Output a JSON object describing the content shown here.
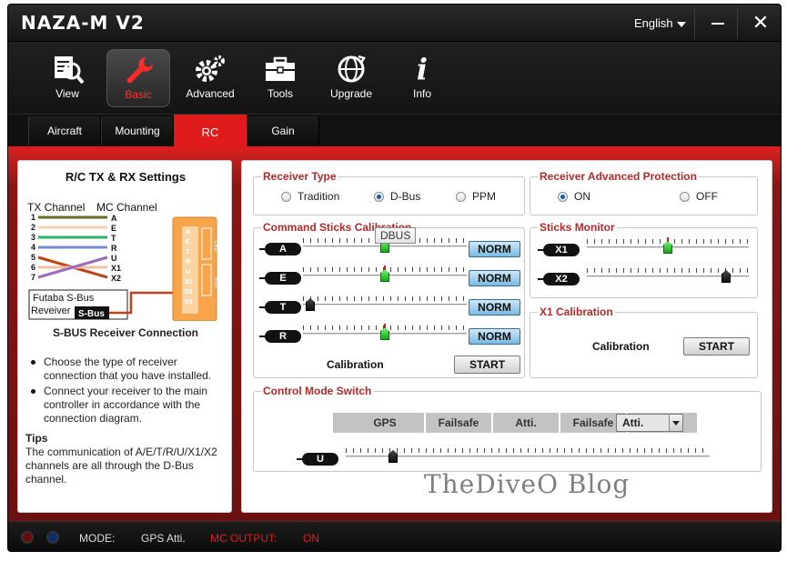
{
  "window": {
    "title": "NAZA-M V2",
    "language": "English",
    "close_glyph": "✕"
  },
  "toolbar": {
    "items": [
      {
        "label": "View",
        "icon": "view-icon"
      },
      {
        "label": "Basic",
        "icon": "wrench-icon",
        "active": true
      },
      {
        "label": "Advanced",
        "icon": "gears-icon"
      },
      {
        "label": "Tools",
        "icon": "toolbox-icon"
      },
      {
        "label": "Upgrade",
        "icon": "upgrade-icon"
      },
      {
        "label": "Info",
        "icon": "info-icon",
        "glyph": "i"
      }
    ]
  },
  "subtabs": [
    "Aircraft",
    "Mounting",
    "RC",
    "Gain"
  ],
  "active_subtab": "RC",
  "left": {
    "title": "R/C TX & RX Settings",
    "tx_channel_label": "TX Channel",
    "mc_channel_label": "MC Channel",
    "tx_numbers": [
      "1",
      "2",
      "3",
      "4",
      "5",
      "6",
      "7"
    ],
    "mc_channels": [
      "A",
      "E",
      "T",
      "R",
      "U",
      "X1",
      "X2"
    ],
    "receiver_name_line1": "Futaba S-Bus",
    "receiver_name_line2": "Reveiver",
    "sbus_tag": "S-Bus",
    "mc_port_labels": [
      "A",
      "E",
      "T",
      "R",
      "U",
      "X1",
      "X2",
      "X3"
    ],
    "mc_side_labels": [
      "LED",
      "EXP"
    ],
    "caption": "S-BUS Receiver Connection",
    "instructions": [
      "Choose the type of receiver connection that you have installed.",
      "Connect your receiver to the main controller in accordance with the connection diagram."
    ],
    "tips_title": "Tips",
    "tips_text": "The communication of A/E/T/R/U/X1/X2 channels are all through the D-Bus channel."
  },
  "receiver_type": {
    "title": "Receiver Type",
    "options": [
      "Tradition",
      "D-Bus",
      "PPM"
    ],
    "selected": "D-Bus"
  },
  "receiver_protection": {
    "title": "Receiver Advanced Protection",
    "options": [
      "ON",
      "OFF"
    ],
    "selected": "ON"
  },
  "command_sticks": {
    "title": "Command Sticks Calibration",
    "tooltip": "DBUS",
    "channels": [
      {
        "name": "A",
        "status": "NORM",
        "value": 0.5
      },
      {
        "name": "E",
        "status": "NORM",
        "value": 0.5
      },
      {
        "name": "T",
        "status": "NORM",
        "value": 0.02
      },
      {
        "name": "R",
        "status": "NORM",
        "value": 0.5
      }
    ],
    "calibration_label": "Calibration",
    "start_label": "START"
  },
  "sticks_monitor": {
    "title": "Sticks Monitor",
    "channels": [
      {
        "name": "X1",
        "value": 0.5
      },
      {
        "name": "X2",
        "value": 0.88
      }
    ]
  },
  "x1_calibration": {
    "title": "X1 Calibration",
    "calibration_label": "Calibration",
    "start_label": "START"
  },
  "control_mode": {
    "title": "Control Mode Switch",
    "cells": [
      "GPS",
      "Failsafe",
      "Atti.",
      "Failsafe"
    ],
    "selected_mode": "Atti.",
    "channel": "U",
    "value": 0.12
  },
  "watermark": "TheDiveO Blog",
  "status": {
    "mode_label": "MODE:",
    "mode_value": "GPS Atti.",
    "output_label": "MC OUTPUT:",
    "output_value": "ON"
  },
  "colors": {
    "accent_red": "#e01b1b",
    "group_title": "#b52a2a",
    "norm_blue": "#7ab8e0",
    "knob_green": "#19a619"
  }
}
